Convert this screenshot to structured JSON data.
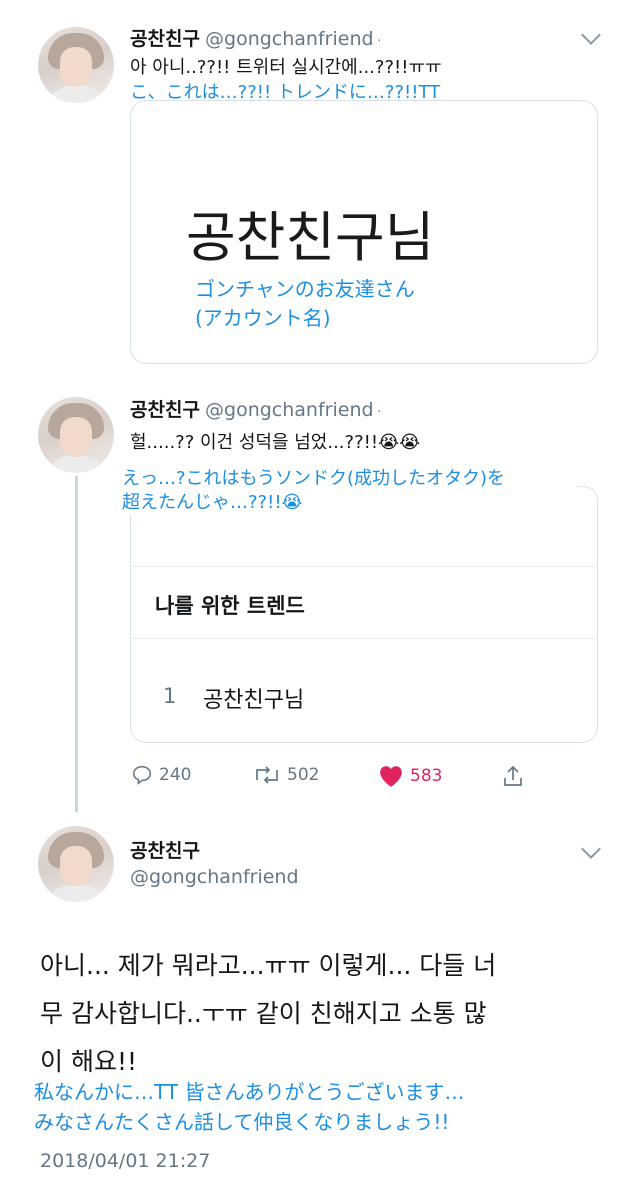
{
  "tweet1": {
    "name": "공찬친구",
    "handle": "@gongchanfriend",
    "text": "아 아니..??!! 트위터 실시간에...??!!ㅠㅠ",
    "translation": "こ、これは…??!! トレンドに…??!!TT",
    "card": {
      "title": "공찬친구님",
      "note_line1": "ゴンチャンのお友達さん",
      "note_line2": "(アカウント名)"
    }
  },
  "tweet2": {
    "name": "공찬친구",
    "handle": "@gongchanfriend",
    "text": "헐.....?? 이건 성덕을 넘었...??!!😭😭",
    "translation_line1": "えっ…?これはもうソンドク(成功したオタク)を",
    "translation_line2": "超えたんじゃ…??!!😭",
    "card": {
      "header": "나를 위한 트렌드",
      "rank": "1",
      "trend": "공찬친구님"
    },
    "actions": {
      "replies": "240",
      "retweets": "502",
      "likes": "583"
    }
  },
  "tweet3": {
    "name": "공찬친구",
    "handle": "@gongchanfriend",
    "text_line1": "아니... 제가 뭐라고...ㅠㅠ 이렇게... 다들 너",
    "text_line2": "무 감사합니다..ㅜㅠ 같이 친해지고 소통 많",
    "text_line3": "이 해요!!",
    "translation_line1": "私なんかに…TT 皆さんありがとうございます…",
    "translation_line2": "みなさんたくさん話して仲良くなりましょう!!",
    "timestamp": "2018/04/01 21:27"
  },
  "colors": {
    "accent": "#1d8fe0",
    "like": "#e0245e",
    "muted": "#657786"
  }
}
